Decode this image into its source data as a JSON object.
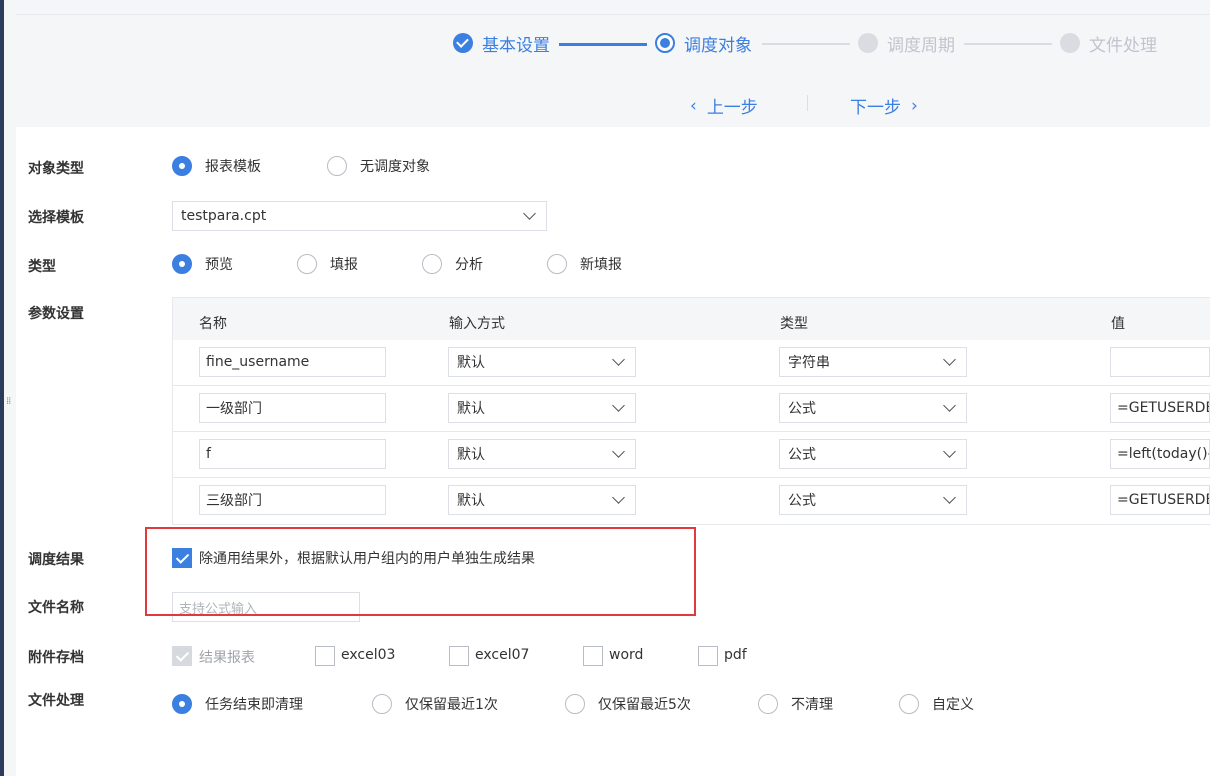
{
  "steps": [
    {
      "label": "基本设置",
      "state": "done"
    },
    {
      "label": "调度对象",
      "state": "active"
    },
    {
      "label": "调度周期",
      "state": "todo"
    },
    {
      "label": "文件处理",
      "state": "todo"
    }
  ],
  "nav": {
    "prev": "上一步",
    "next": "下一步"
  },
  "object_type": {
    "label": "对象类型",
    "options": [
      "报表模板",
      "无调度对象"
    ],
    "selected": "报表模板"
  },
  "template": {
    "label": "选择模板",
    "value": "testpara.cpt"
  },
  "type": {
    "label": "类型",
    "options": [
      "预览",
      "填报",
      "分析",
      "新填报"
    ],
    "selected": "预览"
  },
  "params": {
    "label": "参数设置",
    "headers": [
      "名称",
      "输入方式",
      "类型",
      "值"
    ],
    "rows": [
      {
        "name": "fine_username",
        "input": "默认",
        "type": "字符串",
        "value": ""
      },
      {
        "name": "一级部门",
        "input": "默认",
        "type": "公式",
        "value": "=GETUSERDE"
      },
      {
        "name": "f",
        "input": "默认",
        "type": "公式",
        "value": "=left(today()-"
      },
      {
        "name": "三级部门",
        "input": "默认",
        "type": "公式",
        "value": "=GETUSERDE"
      }
    ]
  },
  "schedule_result": {
    "label": "调度结果",
    "checkbox_text": "除通用结果外，根据默认用户组内的用户单独生成结果",
    "checked": true
  },
  "file_name": {
    "label": "文件名称",
    "placeholder": "支持公式输入"
  },
  "attachments": {
    "label": "附件存档",
    "options": [
      {
        "text": "结果报表",
        "checked": true,
        "disabled": true
      },
      {
        "text": "excel03",
        "checked": false
      },
      {
        "text": "excel07",
        "checked": false
      },
      {
        "text": "word",
        "checked": false
      },
      {
        "text": "pdf",
        "checked": false
      }
    ]
  },
  "file_handling": {
    "label": "文件处理",
    "options": [
      "任务结束即清理",
      "仅保留最近1次",
      "仅保留最近5次",
      "不清理",
      "自定义"
    ],
    "selected": "任务结束即清理"
  },
  "colors": {
    "accent": "#3b7fe0",
    "highlight": "#e0393e"
  }
}
